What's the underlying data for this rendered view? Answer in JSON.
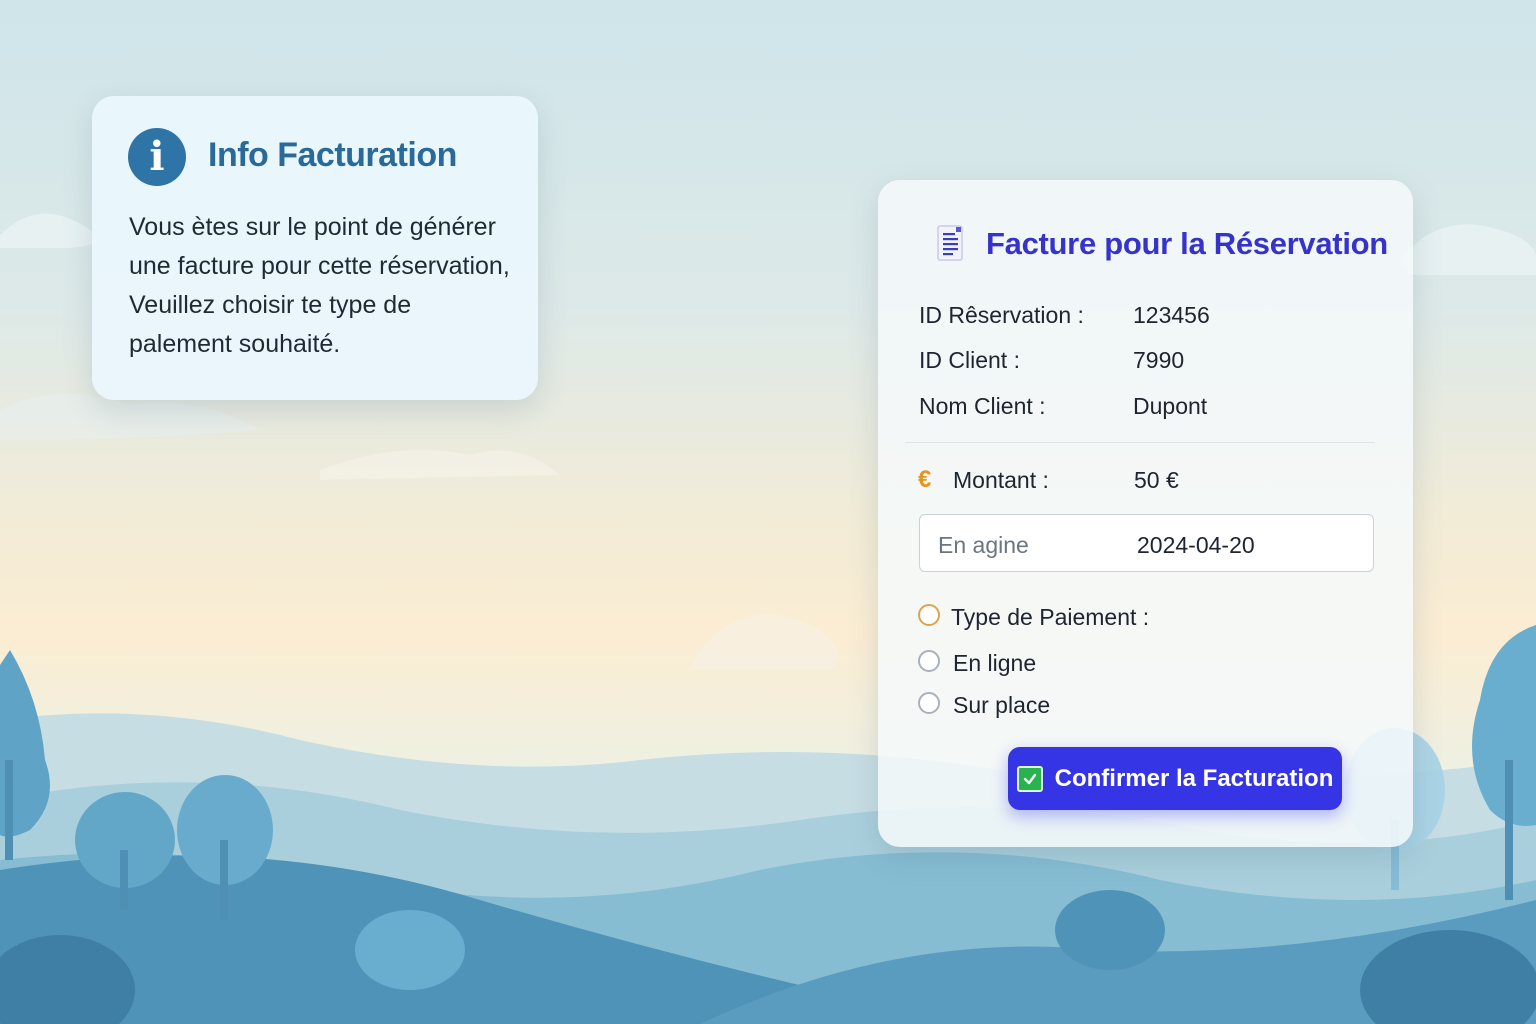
{
  "info_card": {
    "icon": "info-icon",
    "title": "Info Facturation",
    "text": "Vous ètes sur le point de générer une facture pour cette réservation, Veuillez choisir te type de palement souhaité."
  },
  "invoice_card": {
    "icon": "document-icon",
    "title": "Facture pour la Réservation",
    "fields": [
      {
        "label": "ID Rêservation :",
        "value": "123456"
      },
      {
        "label": "ID Client :",
        "value": "7990"
      },
      {
        "label": "Nom Client :",
        "value": "Dupont"
      }
    ],
    "amount": {
      "icon": "euro-icon",
      "symbol": "€",
      "label": "Montant :",
      "value": "50 €"
    },
    "date_field": {
      "placeholder": "En agine",
      "value": "2024-04-20"
    },
    "payment": {
      "label": "Type de Paiement :",
      "options": [
        {
          "label": "En ligne",
          "selected": false
        },
        {
          "label": "Sur place",
          "selected": false
        }
      ]
    },
    "confirm_button": {
      "icon": "check-icon",
      "label": "Confirmer la Facturation"
    }
  },
  "colors": {
    "accent": "#3535e6",
    "info_blue": "#2e74a6",
    "euro": "#e3951f",
    "check": "#27b34d"
  }
}
